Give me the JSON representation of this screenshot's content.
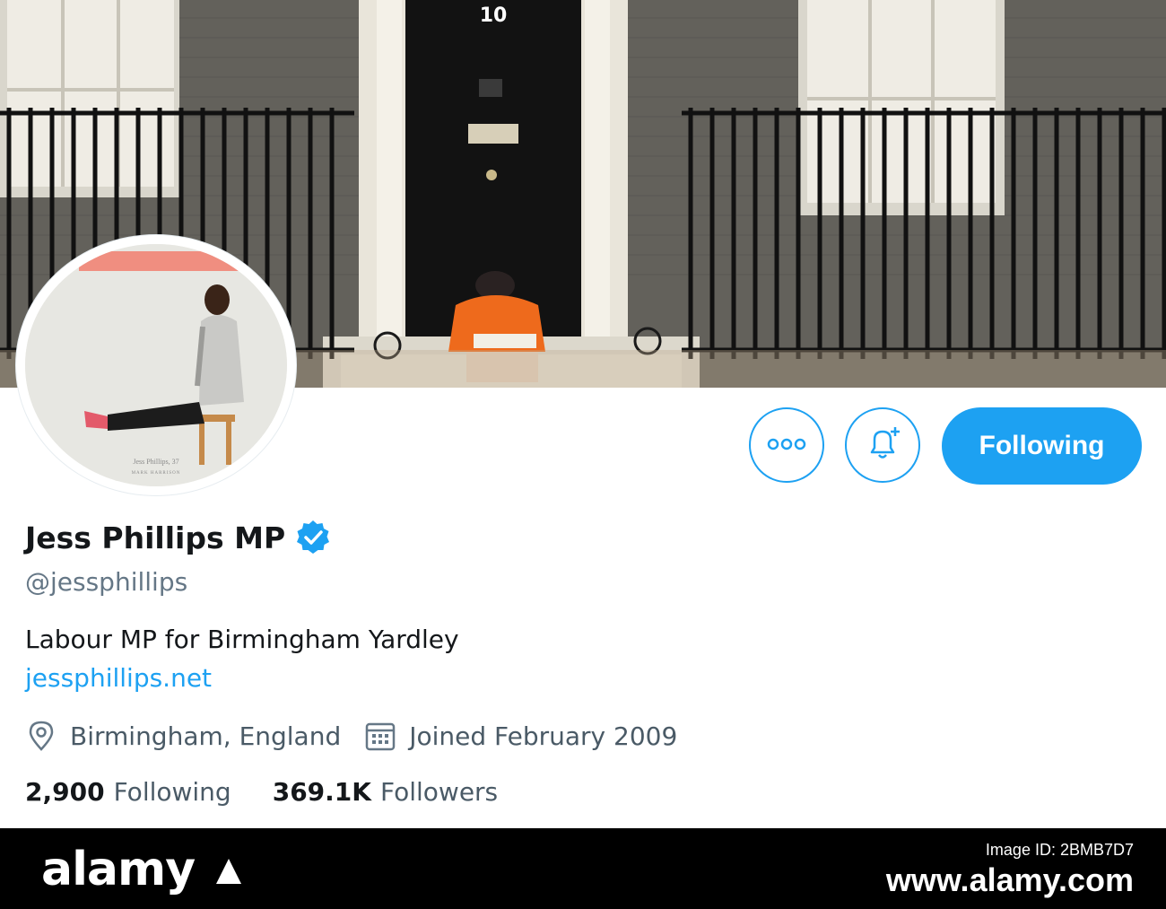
{
  "profile": {
    "display_name": "Jess Phillips MP",
    "handle": "@jessphillips",
    "bio": "Labour MP for Birmingham Yardley",
    "website": "jessphillips.net",
    "location": "Birmingham, England",
    "joined": "Joined February 2009",
    "following_count": "2,900",
    "following_label": "Following",
    "followers_count": "369.1K",
    "followers_label": "Followers",
    "verified_icon": "verified-badge-icon"
  },
  "avatar": {
    "caption_name": "Jess Phillips, 37",
    "caption_credit": "MARK HARRISON"
  },
  "banner": {
    "door_number": "10"
  },
  "actions": {
    "more_icon": "more-dots-icon",
    "notify_icon": "bell-plus-icon",
    "follow_label": "Following"
  },
  "stock": {
    "brand": "alamy",
    "line1": "Image ID: 2BMB7D7",
    "line2": "www.alamy.com"
  },
  "colors": {
    "accent": "#1da1f2",
    "text": "#14171a",
    "muted": "#657786"
  }
}
